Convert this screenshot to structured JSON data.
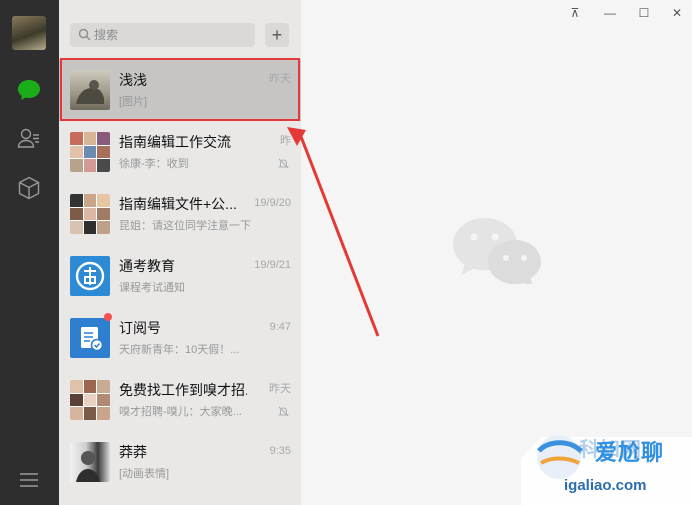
{
  "search": {
    "placeholder": "搜索",
    "add_label": "+"
  },
  "window_controls": {
    "pin": "⊼",
    "minimize": "—",
    "maximize": "☐",
    "close": "✕"
  },
  "chats": [
    {
      "name": "浅浅",
      "time": "昨天",
      "preview": "[图片]",
      "selected": true
    },
    {
      "name": "指南编辑工作交流",
      "time": "昨",
      "preview": "徐康-李：收到",
      "muted": true
    },
    {
      "name": "指南编辑文件+公...",
      "time": "19/9/20",
      "preview": "昆姐：请这位同学注意一下"
    },
    {
      "name": "通考教育",
      "time": "19/9/21",
      "preview": "课程考试通知"
    },
    {
      "name": "订阅号",
      "time": "9:47",
      "preview": "天府新青年：10天假！...",
      "unread": true
    },
    {
      "name": "免费找工作到嗅才招...",
      "time": "昨天",
      "preview": "嗅才招聘-嗅儿：大家晚...",
      "muted": true
    },
    {
      "name": "莽莽",
      "time": "9:35",
      "preview": "[动画表情]"
    }
  ],
  "watermark": {
    "site_name": "科知网",
    "overlay": "爱尬聊",
    "url": "igaliao.com"
  },
  "colors": {
    "nav_bg": "#2e2e2e",
    "list_bg": "#e9e8e7",
    "selected_bg": "#c6c5c4",
    "accent_green": "#1aad19",
    "highlight_red": "#e23a3a"
  }
}
